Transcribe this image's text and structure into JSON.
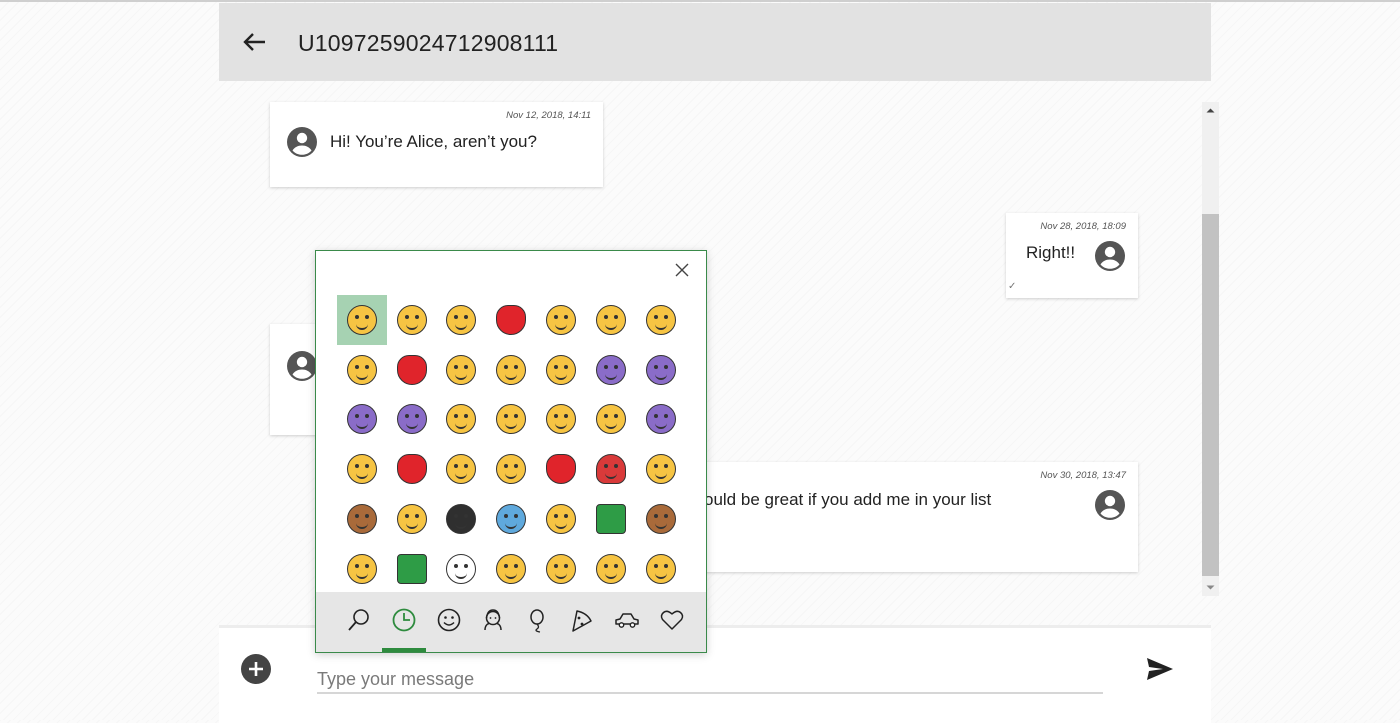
{
  "header": {
    "title": "U1097259024712908111",
    "back_icon": "arrow-left-icon"
  },
  "messages": [
    {
      "time": "Nov 12, 2018, 14:11",
      "text": "Hi! You’re Alice, aren’t you?",
      "side": "left"
    },
    {
      "time": "Nov 28, 2018, 18:09",
      "text": "Right!!",
      "side": "right",
      "status": "✓"
    },
    {
      "time": "",
      "text": "",
      "side": "left"
    },
    {
      "time": "Nov 30, 2018, 13:47",
      "text": "ould be great if you add me in your list",
      "side": "right"
    }
  ],
  "composer": {
    "placeholder": "Type your message",
    "value": "",
    "add_icon": "add-circle-icon",
    "send_icon": "send-icon"
  },
  "emoji_picker": {
    "close_icon": "close-icon",
    "selected_index": 0,
    "emojis": [
      "😊",
      "😂",
      "🤣",
      "❤️",
      "😍",
      "😒",
      "👌",
      "😘",
      "💕",
      "😁",
      "👍",
      "🙌",
      "🤦",
      "🤦",
      "🤷",
      "🤷",
      "✌️",
      "🤞",
      "😉",
      "😎",
      "🎶",
      "😢",
      "💖",
      "😜",
      "👏",
      "💋",
      "🌹",
      "🎉",
      "🎂",
      "🤳",
      "🐱",
      "🚀",
      "🎁",
      "🐉",
      "🦊",
      "🤯",
      "✔️",
      "👀",
      "😃",
      "✨",
      "😆",
      "🤔"
    ],
    "categories": [
      {
        "name": "search",
        "icon": "search-icon"
      },
      {
        "name": "recent",
        "icon": "clock-icon",
        "active": true
      },
      {
        "name": "smileys",
        "icon": "smiley-icon"
      },
      {
        "name": "people",
        "icon": "person-icon"
      },
      {
        "name": "celebration",
        "icon": "balloon-icon"
      },
      {
        "name": "food",
        "icon": "pizza-icon"
      },
      {
        "name": "travel",
        "icon": "car-icon"
      },
      {
        "name": "symbols",
        "icon": "heart-icon"
      }
    ]
  }
}
